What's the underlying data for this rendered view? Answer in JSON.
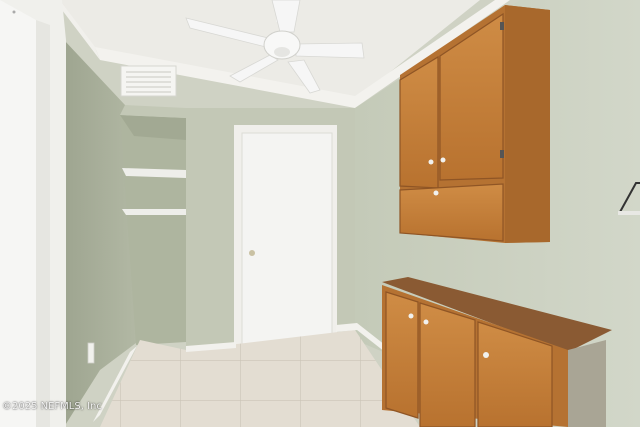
{
  "scene": {
    "description_kind": "interior-photo",
    "watermark_text": "©2025 NEFMLS, Inc"
  },
  "colors": {
    "ceiling": "#ecebe6",
    "wall_left": "#a9b09b",
    "wall_back": "#c3c8b6",
    "wall_right": "#cbd1c2",
    "closet_interior": "#aeb59f",
    "door": "#f4f4f2",
    "trim": "#f0efeb",
    "floor_tile": "#e3ddd2",
    "cabinet_wood": "#c9853e",
    "cabinet_dark": "#9b5f28",
    "countertop": "#8a5a33",
    "fan_white": "#f6f6f6"
  }
}
